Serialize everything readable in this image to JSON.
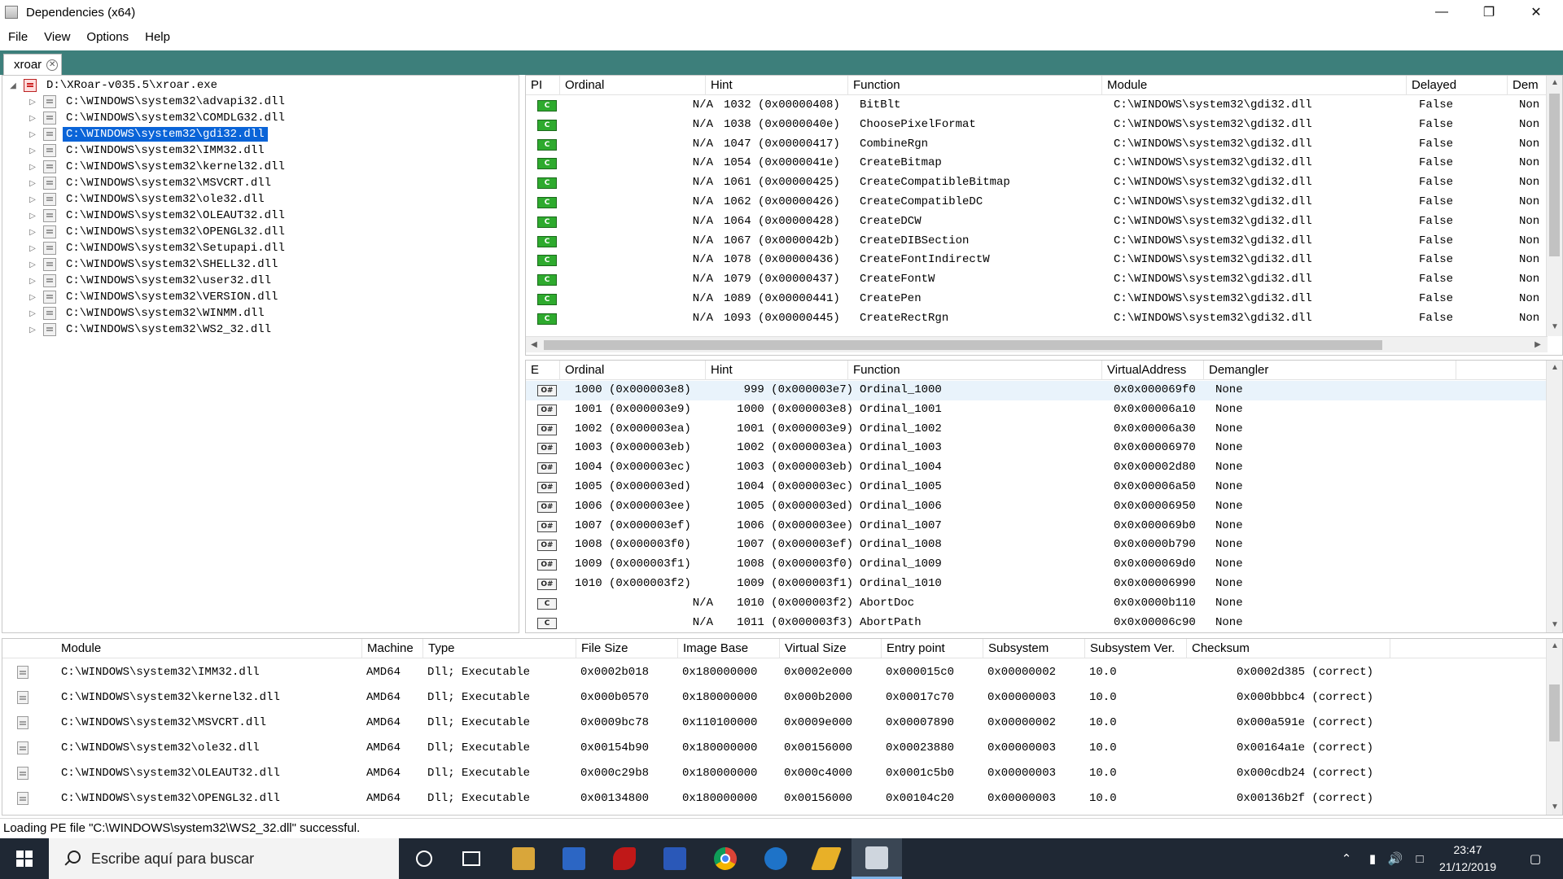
{
  "window": {
    "title": "Dependencies (x64)"
  },
  "menu": [
    "File",
    "View",
    "Options",
    "Help"
  ],
  "tab": {
    "label": "xroar"
  },
  "tree": {
    "root": "D:\\XRoar-v035.5\\xroar.exe",
    "children": [
      "C:\\WINDOWS\\system32\\advapi32.dll",
      "C:\\WINDOWS\\system32\\COMDLG32.dll",
      "C:\\WINDOWS\\system32\\gdi32.dll",
      "C:\\WINDOWS\\system32\\IMM32.dll",
      "C:\\WINDOWS\\system32\\kernel32.dll",
      "C:\\WINDOWS\\system32\\MSVCRT.dll",
      "C:\\WINDOWS\\system32\\ole32.dll",
      "C:\\WINDOWS\\system32\\OLEAUT32.dll",
      "C:\\WINDOWS\\system32\\OPENGL32.dll",
      "C:\\WINDOWS\\system32\\Setupapi.dll",
      "C:\\WINDOWS\\system32\\SHELL32.dll",
      "C:\\WINDOWS\\system32\\user32.dll",
      "C:\\WINDOWS\\system32\\VERSION.dll",
      "C:\\WINDOWS\\system32\\WINMM.dll",
      "C:\\WINDOWS\\system32\\WS2_32.dll"
    ],
    "selected": "C:\\WINDOWS\\system32\\gdi32.dll"
  },
  "imports": {
    "columns": [
      "PI",
      "Ordinal",
      "Hint",
      "Function",
      "Module",
      "Delayed",
      "Dem"
    ],
    "rows": [
      {
        "ordinal": "N/A",
        "hint": "1032 (0x00000408)",
        "function": "BitBlt",
        "module": "C:\\WINDOWS\\system32\\gdi32.dll",
        "delayed": "False",
        "dem": "Non"
      },
      {
        "ordinal": "N/A",
        "hint": "1038 (0x0000040e)",
        "function": "ChoosePixelFormat",
        "module": "C:\\WINDOWS\\system32\\gdi32.dll",
        "delayed": "False",
        "dem": "Non"
      },
      {
        "ordinal": "N/A",
        "hint": "1047 (0x00000417)",
        "function": "CombineRgn",
        "module": "C:\\WINDOWS\\system32\\gdi32.dll",
        "delayed": "False",
        "dem": "Non"
      },
      {
        "ordinal": "N/A",
        "hint": "1054 (0x0000041e)",
        "function": "CreateBitmap",
        "module": "C:\\WINDOWS\\system32\\gdi32.dll",
        "delayed": "False",
        "dem": "Non"
      },
      {
        "ordinal": "N/A",
        "hint": "1061 (0x00000425)",
        "function": "CreateCompatibleBitmap",
        "module": "C:\\WINDOWS\\system32\\gdi32.dll",
        "delayed": "False",
        "dem": "Non"
      },
      {
        "ordinal": "N/A",
        "hint": "1062 (0x00000426)",
        "function": "CreateCompatibleDC",
        "module": "C:\\WINDOWS\\system32\\gdi32.dll",
        "delayed": "False",
        "dem": "Non"
      },
      {
        "ordinal": "N/A",
        "hint": "1064 (0x00000428)",
        "function": "CreateDCW",
        "module": "C:\\WINDOWS\\system32\\gdi32.dll",
        "delayed": "False",
        "dem": "Non"
      },
      {
        "ordinal": "N/A",
        "hint": "1067 (0x0000042b)",
        "function": "CreateDIBSection",
        "module": "C:\\WINDOWS\\system32\\gdi32.dll",
        "delayed": "False",
        "dem": "Non"
      },
      {
        "ordinal": "N/A",
        "hint": "1078 (0x00000436)",
        "function": "CreateFontIndirectW",
        "module": "C:\\WINDOWS\\system32\\gdi32.dll",
        "delayed": "False",
        "dem": "Non"
      },
      {
        "ordinal": "N/A",
        "hint": "1079 (0x00000437)",
        "function": "CreateFontW",
        "module": "C:\\WINDOWS\\system32\\gdi32.dll",
        "delayed": "False",
        "dem": "Non"
      },
      {
        "ordinal": "N/A",
        "hint": "1089 (0x00000441)",
        "function": "CreatePen",
        "module": "C:\\WINDOWS\\system32\\gdi32.dll",
        "delayed": "False",
        "dem": "Non"
      },
      {
        "ordinal": "N/A",
        "hint": "1093 (0x00000445)",
        "function": "CreateRectRgn",
        "module": "C:\\WINDOWS\\system32\\gdi32.dll",
        "delayed": "False",
        "dem": "Non"
      }
    ]
  },
  "exports": {
    "columns": [
      "E",
      "Ordinal",
      "Hint",
      "Function",
      "VirtualAddress",
      "Demangler"
    ],
    "rows": [
      {
        "kind": "ord",
        "ordinal": "1000 (0x000003e8)",
        "hint": "999 (0x000003e7)",
        "function": "Ordinal_1000",
        "va": "0x0x000069f0",
        "dem": "None"
      },
      {
        "kind": "ord",
        "ordinal": "1001 (0x000003e9)",
        "hint": "1000 (0x000003e8)",
        "function": "Ordinal_1001",
        "va": "0x0x00006a10",
        "dem": "None"
      },
      {
        "kind": "ord",
        "ordinal": "1002 (0x000003ea)",
        "hint": "1001 (0x000003e9)",
        "function": "Ordinal_1002",
        "va": "0x0x00006a30",
        "dem": "None"
      },
      {
        "kind": "ord",
        "ordinal": "1003 (0x000003eb)",
        "hint": "1002 (0x000003ea)",
        "function": "Ordinal_1003",
        "va": "0x0x00006970",
        "dem": "None"
      },
      {
        "kind": "ord",
        "ordinal": "1004 (0x000003ec)",
        "hint": "1003 (0x000003eb)",
        "function": "Ordinal_1004",
        "va": "0x0x00002d80",
        "dem": "None"
      },
      {
        "kind": "ord",
        "ordinal": "1005 (0x000003ed)",
        "hint": "1004 (0x000003ec)",
        "function": "Ordinal_1005",
        "va": "0x0x00006a50",
        "dem": "None"
      },
      {
        "kind": "ord",
        "ordinal": "1006 (0x000003ee)",
        "hint": "1005 (0x000003ed)",
        "function": "Ordinal_1006",
        "va": "0x0x00006950",
        "dem": "None"
      },
      {
        "kind": "ord",
        "ordinal": "1007 (0x000003ef)",
        "hint": "1006 (0x000003ee)",
        "function": "Ordinal_1007",
        "va": "0x0x000069b0",
        "dem": "None"
      },
      {
        "kind": "ord",
        "ordinal": "1008 (0x000003f0)",
        "hint": "1007 (0x000003ef)",
        "function": "Ordinal_1008",
        "va": "0x0x0000b790",
        "dem": "None"
      },
      {
        "kind": "ord",
        "ordinal": "1009 (0x000003f1)",
        "hint": "1008 (0x000003f0)",
        "function": "Ordinal_1009",
        "va": "0x0x000069d0",
        "dem": "None"
      },
      {
        "kind": "ord",
        "ordinal": "1010 (0x000003f2)",
        "hint": "1009 (0x000003f1)",
        "function": "Ordinal_1010",
        "va": "0x0x00006990",
        "dem": "None"
      },
      {
        "kind": "name",
        "ordinal": "N/A",
        "hint": "1010 (0x000003f2)",
        "function": "AbortDoc",
        "va": "0x0x0000b110",
        "dem": "None"
      },
      {
        "kind": "name",
        "ordinal": "N/A",
        "hint": "1011 (0x000003f3)",
        "function": "AbortPath",
        "va": "0x0x00006c90",
        "dem": "None"
      }
    ]
  },
  "modules": {
    "columns": [
      "Module",
      "Machine",
      "Type",
      "File Size",
      "Image Base",
      "Virtual Size",
      "Entry point",
      "Subsystem",
      "Subsystem Ver.",
      "Checksum"
    ],
    "rows": [
      {
        "module": "C:\\WINDOWS\\system32\\IMM32.dll",
        "machine": "AMD64",
        "type": "Dll; Executable",
        "filesize": "0x0002b018",
        "imagebase": "0x180000000",
        "vsize": "0x0002e000",
        "entry": "0x000015c0",
        "subsystem": "0x00000002",
        "subver": "10.0",
        "checksum": "0x0002d385 (correct)"
      },
      {
        "module": "C:\\WINDOWS\\system32\\kernel32.dll",
        "machine": "AMD64",
        "type": "Dll; Executable",
        "filesize": "0x000b0570",
        "imagebase": "0x180000000",
        "vsize": "0x000b2000",
        "entry": "0x00017c70",
        "subsystem": "0x00000003",
        "subver": "10.0",
        "checksum": "0x000bbbc4 (correct)"
      },
      {
        "module": "C:\\WINDOWS\\system32\\MSVCRT.dll",
        "machine": "AMD64",
        "type": "Dll; Executable",
        "filesize": "0x0009bc78",
        "imagebase": "0x110100000",
        "vsize": "0x0009e000",
        "entry": "0x00007890",
        "subsystem": "0x00000002",
        "subver": "10.0",
        "checksum": "0x000a591e (correct)"
      },
      {
        "module": "C:\\WINDOWS\\system32\\ole32.dll",
        "machine": "AMD64",
        "type": "Dll; Executable",
        "filesize": "0x00154b90",
        "imagebase": "0x180000000",
        "vsize": "0x00156000",
        "entry": "0x00023880",
        "subsystem": "0x00000003",
        "subver": "10.0",
        "checksum": "0x00164a1e (correct)"
      },
      {
        "module": "C:\\WINDOWS\\system32\\OLEAUT32.dll",
        "machine": "AMD64",
        "type": "Dll; Executable",
        "filesize": "0x000c29b8",
        "imagebase": "0x180000000",
        "vsize": "0x000c4000",
        "entry": "0x0001c5b0",
        "subsystem": "0x00000003",
        "subver": "10.0",
        "checksum": "0x000cdb24 (correct)"
      },
      {
        "module": "C:\\WINDOWS\\system32\\OPENGL32.dll",
        "machine": "AMD64",
        "type": "Dll; Executable",
        "filesize": "0x00134800",
        "imagebase": "0x180000000",
        "vsize": "0x00156000",
        "entry": "0x00104c20",
        "subsystem": "0x00000003",
        "subver": "10.0",
        "checksum": "0x00136b2f (correct)"
      }
    ]
  },
  "status": {
    "text": "Loading PE file \"C:\\WINDOWS\\system32\\WS2_32.dll\" successful."
  },
  "taskbar": {
    "search_placeholder": "Escribe aquí para buscar",
    "time": "23:47",
    "date": "21/12/2019"
  },
  "colors": {
    "accent_tabstrip": "#3d7f7b",
    "selection": "#0a64d8",
    "taskbar": "#1f2834"
  },
  "icons": {
    "import_badge": "C",
    "export_badge": "O#",
    "name_badge": "C"
  }
}
